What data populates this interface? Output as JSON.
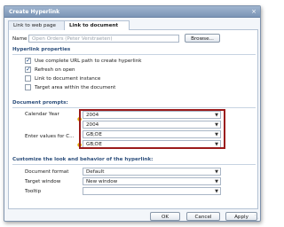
{
  "window": {
    "title": "Create Hyperlink",
    "close_glyph": "×"
  },
  "tabs": [
    {
      "label": "Link to web page",
      "active": false
    },
    {
      "label": "Link to document",
      "active": true
    }
  ],
  "name_row": {
    "label": "Name",
    "placeholder": "Open Orders (Peter Verstraeten)",
    "button": "Browse..."
  },
  "hyperlink_properties": {
    "heading": "Hyperlink properties",
    "options": [
      {
        "label": "Use complete URL path to create hyperlink",
        "checked": true
      },
      {
        "label": "Refresh on open",
        "checked": true
      },
      {
        "label": "Link to document instance",
        "checked": false
      },
      {
        "label": "Target area within the document",
        "checked": false
      }
    ]
  },
  "document_prompts": {
    "heading": "Document prompts:",
    "rows": [
      {
        "label": "Calendar Year",
        "value_1": "2004",
        "value_2": "2004"
      },
      {
        "label": "Enter values for C...",
        "value_1": "GB;DE",
        "value_2": "GB;DE"
      }
    ]
  },
  "customize": {
    "heading": "Customize the look and behavior of the hyperlink:",
    "rows": [
      {
        "label": "Document format",
        "value": "Default"
      },
      {
        "label": "Target window",
        "value": "New window"
      },
      {
        "label": "Tooltip",
        "value": ""
      }
    ]
  },
  "buttons": {
    "ok": "OK",
    "cancel": "Cancel",
    "apply": "Apply"
  },
  "icons": {
    "bulb": "lightbulb-icon",
    "dropdown": "chevron-down-icon",
    "close": "close-icon"
  },
  "colors": {
    "accent": "#2d4f7c",
    "highlight": "#9b1b1b",
    "titlebar": "#7b95b6"
  }
}
